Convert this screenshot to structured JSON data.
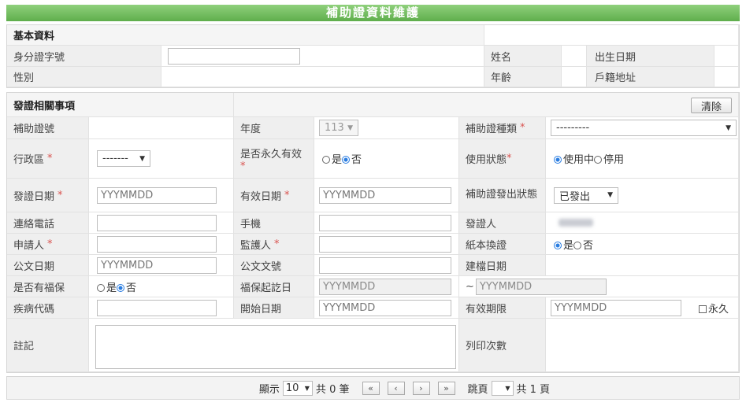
{
  "title": "補助證資料維護",
  "basic": {
    "section_title": "基本資料",
    "id_label": "身分證字號",
    "name_label": "姓名",
    "birth_label": "出生日期",
    "gender_label": "性別",
    "age_label": "年齡",
    "address_label": "戶籍地址"
  },
  "issue": {
    "section_title": "發證相關事項",
    "clear_button": "清除",
    "cert_no_label": "補助證號",
    "year_label": "年度",
    "year_value": "113",
    "cert_type_label": "補助證種類",
    "cert_type_value": "---------",
    "district_label": "行政區",
    "district_value": "-------",
    "permanent_label": "是否永久有效",
    "yes": "是",
    "no": "否",
    "use_status_label": "使用狀態",
    "in_use": "使用中",
    "stopped": "停用",
    "issue_date_label": "發證日期",
    "date_placeholder": "YYYMMDD",
    "valid_date_label": "有效日期",
    "issued_state_label": "補助證發出狀態",
    "issued_state_value": "已發出",
    "phone_label": "連絡電話",
    "mobile_label": "手機",
    "issuer_label": "發證人",
    "applicant_label": "申請人",
    "guardian_label": "監護人",
    "paper_label": "紙本換證",
    "doc_date_label": "公文日期",
    "doc_no_label": "公文文號",
    "created_date_label": "建檔日期",
    "welfare_label": "是否有福保",
    "welfare_start_label": "福保起訖日",
    "tilde": "~",
    "disease_label": "疾病代碼",
    "start_date_label": "開始日期",
    "valid_period_label": "有效期限",
    "permanent_check": "永久",
    "note_label": "註記",
    "print_count_label": "列印次數"
  },
  "pager": {
    "show": "顯示",
    "page_size": "10",
    "total_prefix": "共",
    "total_count": "0",
    "total_suffix": "筆",
    "first": "«",
    "prev": "‹",
    "next": "›",
    "last": "»",
    "jump": "跳頁",
    "pages_prefix": "共",
    "pages_count": "1",
    "pages_suffix": "頁"
  }
}
